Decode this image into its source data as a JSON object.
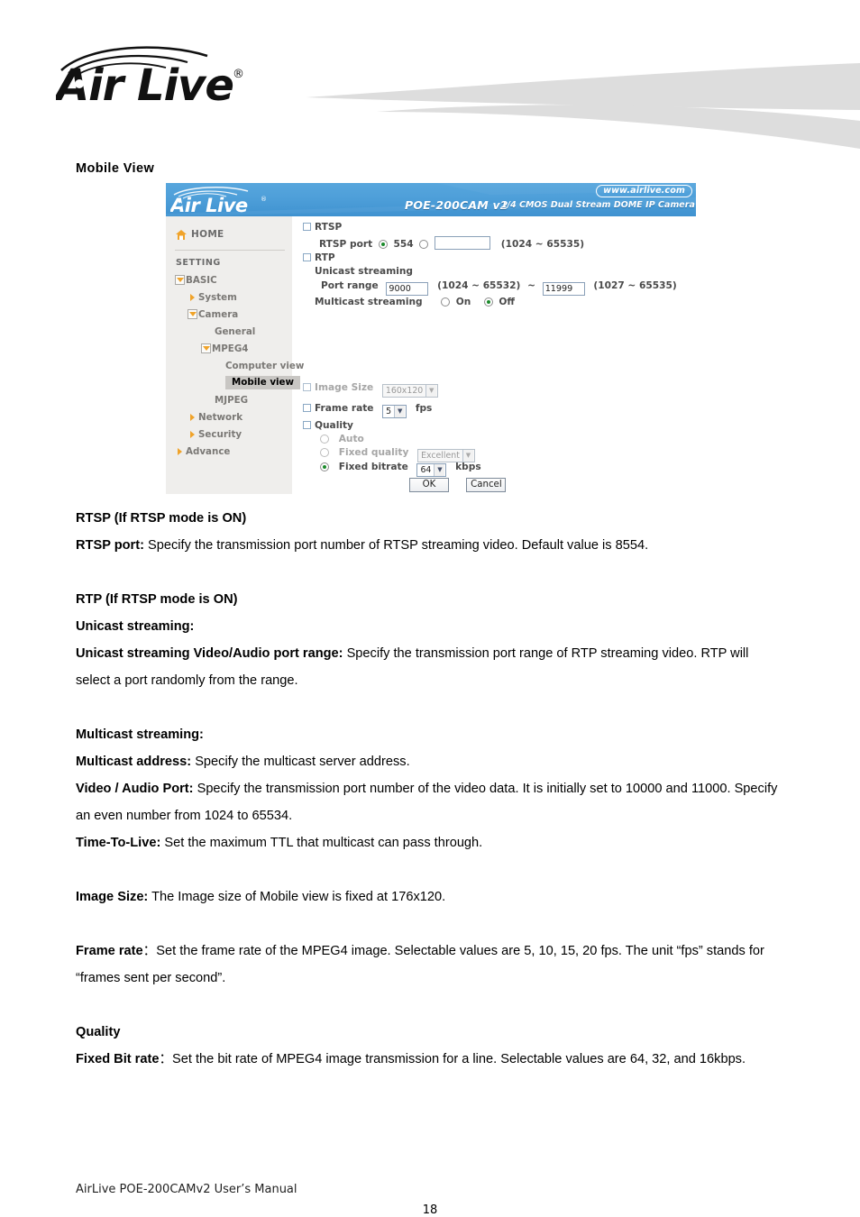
{
  "header": {
    "brand": "Air Live",
    "brand_registered": "®"
  },
  "document": {
    "section_heading": "Mobile View",
    "blocks": [
      {
        "kind": "heading",
        "text": "RTSP (If RTSP mode is ON)"
      },
      {
        "kind": "para",
        "bold": "RTSP port:",
        "text": " Specify the transmission port number of RTSP streaming video. Default value is 8554."
      },
      {
        "kind": "spacer"
      },
      {
        "kind": "heading",
        "text": "RTP (If RTSP mode is ON)"
      },
      {
        "kind": "heading",
        "text": "Unicast streaming:"
      },
      {
        "kind": "para",
        "bold": "Unicast streaming Video/Audio port range:",
        "text": " Specify the transmission port range of RTP streaming video. RTP will select a port randomly from the range."
      },
      {
        "kind": "spacer"
      },
      {
        "kind": "heading",
        "text": "Multicast streaming:"
      },
      {
        "kind": "para",
        "bold": "Multicast address:",
        "text": " Specify the multicast server address."
      },
      {
        "kind": "para",
        "bold": "Video / Audio Port:",
        "text": " Specify the transmission port number of the video data. It is initially set to 10000 and 11000. Specify an even number from 1024 to 65534."
      },
      {
        "kind": "para",
        "bold": "Time-To-Live:",
        "text": " Set the maximum TTL that multicast can pass through."
      },
      {
        "kind": "spacer"
      },
      {
        "kind": "para",
        "bold": "Image Size:",
        "text": " The Image size of Mobile view is fixed at 176x120."
      },
      {
        "kind": "spacer"
      },
      {
        "kind": "para",
        "bold": "Frame rate",
        "text": "：Set the frame rate of the MPEG4 image. Selectable values are 5, 10, 15, 20 fps. The unit “fps” stands for “frames sent per second”."
      },
      {
        "kind": "spacer"
      },
      {
        "kind": "heading",
        "text": "Quality"
      },
      {
        "kind": "para",
        "bold": "Fixed Bit rate",
        "text": "：Set the bit rate of MPEG4 image transmission for a line. Selectable values are 64, 32, and 16kbps."
      }
    ]
  },
  "screenshot": {
    "banner": {
      "logo": "Air Live",
      "model": "POE-200CAM v2",
      "description": "1/4 CMOS Dual Stream DOME IP Camera",
      "url": "www.airlive.com"
    },
    "sidebar": {
      "home": "HOME",
      "setting": "SETTING",
      "items": [
        {
          "label": "BASIC",
          "level": 1,
          "arrow": "down",
          "selected": false
        },
        {
          "label": "System",
          "level": 2,
          "arrow": "right",
          "selected": false
        },
        {
          "label": "Camera",
          "level": 2,
          "arrow": "down",
          "selected": false
        },
        {
          "label": "General",
          "level": 4,
          "arrow": "none",
          "selected": false
        },
        {
          "label": "MPEG4",
          "level": 3,
          "arrow": "down",
          "selected": false
        },
        {
          "label": "Computer view",
          "level": 5,
          "arrow": "none",
          "selected": false
        },
        {
          "label": "Mobile view",
          "level": 5,
          "arrow": "none",
          "selected": true
        },
        {
          "label": "MJPEG",
          "level": 4,
          "arrow": "none",
          "selected": false
        },
        {
          "label": "Network",
          "level": 2,
          "arrow": "right",
          "selected": false
        },
        {
          "label": "Security",
          "level": 2,
          "arrow": "right",
          "selected": false
        },
        {
          "label": "Advance",
          "level": 1,
          "arrow": "right",
          "selected": false
        }
      ]
    },
    "form": {
      "rtsp_group": "RTSP",
      "rtsp_port_label": "RTSP port",
      "rtsp_port_default": "554",
      "rtsp_port_custom_value": "",
      "rtsp_port_hint": "(1024 ~ 65535)",
      "rtp_group": "RTP",
      "unicast_label": "Unicast streaming",
      "port_range_label": "Port range",
      "port_range_start": "9000",
      "port_range_start_hint": "(1024 ~ 65532)",
      "port_range_sep": "~",
      "port_range_end": "11999",
      "port_range_end_hint": "(1027 ~ 65535)",
      "multicast_label": "Multicast streaming",
      "multicast_on": "On",
      "multicast_off": "Off",
      "image_size_label": "Image Size",
      "image_size_value": "160x120",
      "frame_rate_label": "Frame rate",
      "frame_rate_value": "5",
      "frame_rate_unit": "fps",
      "quality_label": "Quality",
      "auto_label": "Auto",
      "fixed_quality_label": "Fixed quality",
      "fixed_quality_value": "Excellent",
      "fixed_bitrate_label": "Fixed bitrate",
      "fixed_bitrate_value": "64",
      "fixed_bitrate_unit": "kbps",
      "ok_button": "OK",
      "cancel_button": "Cancel"
    }
  },
  "footer": {
    "manual_title": "AirLive POE-200CAMv2 User’s Manual",
    "page_number": "18"
  },
  "colors": {
    "banner_blue": "#4a9bd8",
    "sidebar_gray": "#efeeec",
    "accent_orange": "#f0a32a",
    "swoosh_gray": "#dddddd"
  }
}
